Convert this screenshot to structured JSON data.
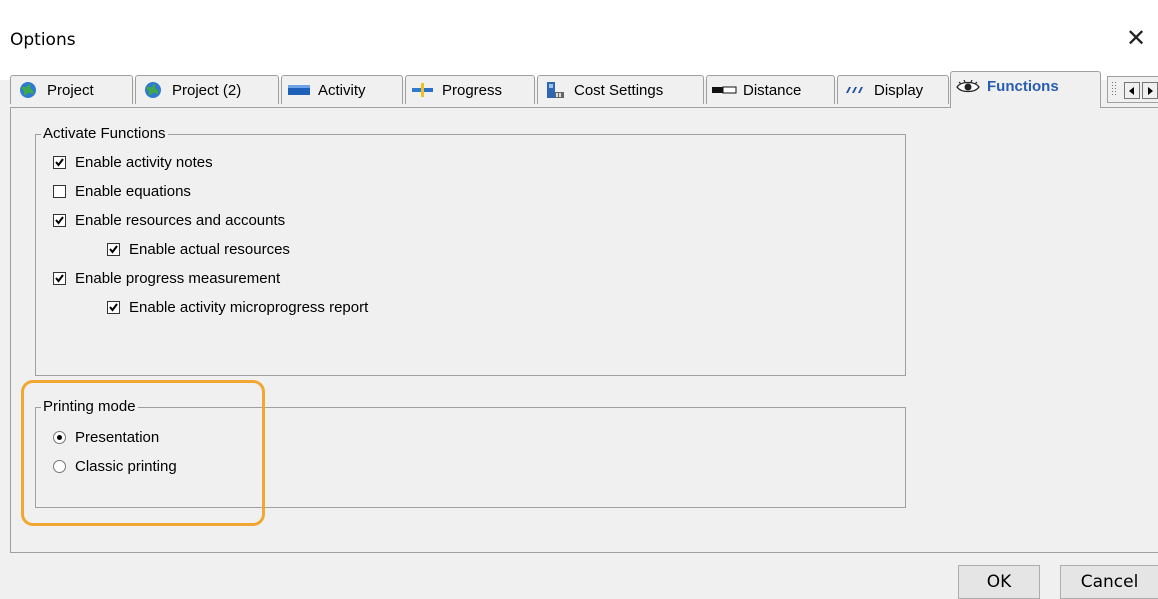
{
  "window": {
    "title": "Options",
    "close_symbol": "✕"
  },
  "tabs": [
    {
      "label": "Project",
      "icon": "globe-icon",
      "active": false
    },
    {
      "label": "Project (2)",
      "icon": "globe-icon",
      "active": false
    },
    {
      "label": "Activity",
      "icon": "activity-bar-icon",
      "active": false
    },
    {
      "label": "Progress",
      "icon": "progress-icon",
      "active": false
    },
    {
      "label": "Cost Settings",
      "icon": "cost-settings-icon",
      "active": false
    },
    {
      "label": "Distance",
      "icon": "distance-icon",
      "active": false
    },
    {
      "label": "Display",
      "icon": "display-icon",
      "active": false
    },
    {
      "label": "Functions",
      "icon": "eye-icon",
      "active": true
    }
  ],
  "activate_functions": {
    "legend": "Activate Functions",
    "items": [
      {
        "label": "Enable activity notes",
        "checked": true
      },
      {
        "label": "Enable equations",
        "checked": false
      },
      {
        "label": "Enable resources and accounts",
        "checked": true
      },
      {
        "label": "Enable actual resources",
        "checked": true
      },
      {
        "label": "Enable progress measurement",
        "checked": true
      },
      {
        "label": "Enable activity microprogress report",
        "checked": true
      }
    ]
  },
  "printing_mode": {
    "legend": "Printing mode",
    "options": [
      {
        "label": "Presentation",
        "selected": true
      },
      {
        "label": "Classic printing",
        "selected": false
      }
    ]
  },
  "buttons": {
    "ok": "OK",
    "cancel": "Cancel"
  },
  "colors": {
    "highlight": "#f0a833",
    "active_tab_text": "#2a5db0"
  }
}
